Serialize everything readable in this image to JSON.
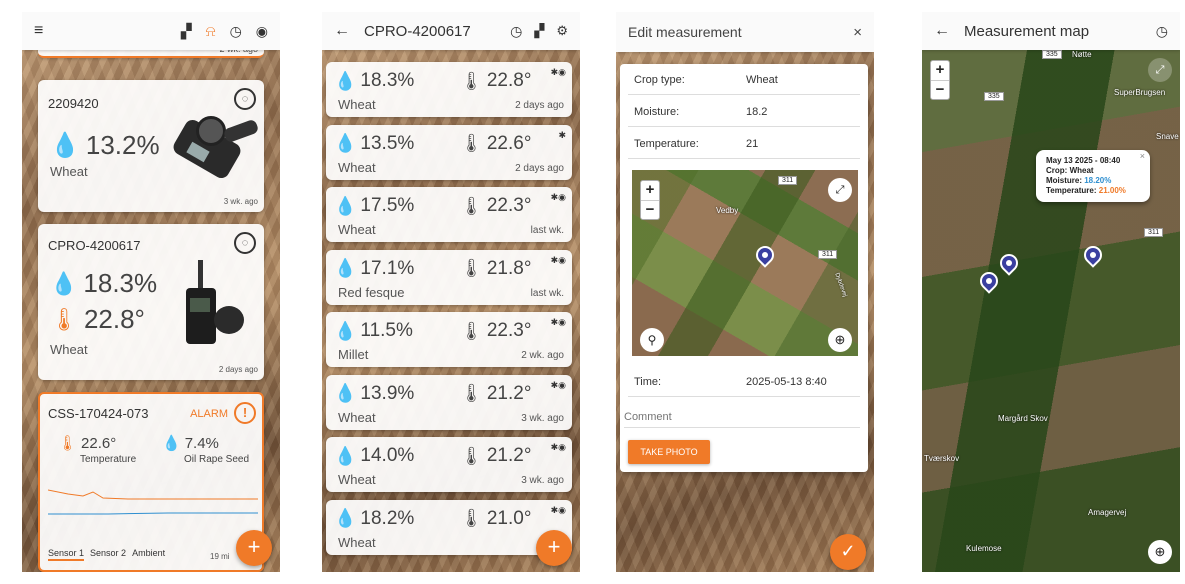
{
  "screen1": {
    "top_card_partial": "2 wk. ago",
    "devices": [
      {
        "name": "2209420",
        "moisture": "13.2%",
        "crop": "Wheat",
        "age": "3 wk. ago"
      },
      {
        "name": "CPRO-4200617",
        "moisture": "18.3%",
        "temperature": "22.8°",
        "crop": "Wheat",
        "age": "2 days ago"
      }
    ],
    "alarm_device": {
      "name": "CSS-170424-073",
      "alarm_label": "ALARM",
      "temperature": "22.6°",
      "temperature_label": "Temperature",
      "moisture": "7.4%",
      "crop": "Oil Rape Seed",
      "tabs": [
        "Sensor 1",
        "Sensor 2",
        "Ambient"
      ],
      "age": "19 mi"
    },
    "fab": "+"
  },
  "screen2": {
    "title": "CPRO-4200617",
    "rows": [
      {
        "moisture": "18.3%",
        "temperature": "22.8°",
        "crop": "Wheat",
        "age": "2 days ago",
        "bt": "✱◉"
      },
      {
        "moisture": "13.5%",
        "temperature": "22.6°",
        "crop": "Wheat",
        "age": "2 days ago",
        "bt": "✱"
      },
      {
        "moisture": "17.5%",
        "temperature": "22.3°",
        "crop": "Wheat",
        "age": "last wk.",
        "bt": "✱◉"
      },
      {
        "moisture": "17.1%",
        "temperature": "21.8°",
        "crop": "Red fesque",
        "age": "last wk.",
        "bt": "✱◉"
      },
      {
        "moisture": "11.5%",
        "temperature": "22.3°",
        "crop": "Millet",
        "age": "2 wk. ago",
        "bt": "✱◉"
      },
      {
        "moisture": "13.9%",
        "temperature": "21.2°",
        "crop": "Wheat",
        "age": "3 wk. ago",
        "bt": "✱◉"
      },
      {
        "moisture": "14.0%",
        "temperature": "21.2°",
        "crop": "Wheat",
        "age": "3 wk. ago",
        "bt": "✱◉"
      },
      {
        "moisture": "18.2%",
        "temperature": "21.0°",
        "crop": "Wheat",
        "age": "3 w",
        "bt": "✱◉"
      }
    ],
    "fab": "+"
  },
  "screen3": {
    "title": "Edit measurement",
    "close": "×",
    "fields": [
      {
        "label": "Crop type:",
        "value": "Wheat"
      },
      {
        "label": "Moisture:",
        "value": "18.2"
      },
      {
        "label": "Temperature:",
        "value": "21"
      }
    ],
    "map": {
      "place": "Vedby",
      "road1": "311",
      "road2": "311",
      "road3": "Dybdevej"
    },
    "time_label": "Time:",
    "time_value": "2025-05-13 8:40",
    "comment_placeholder": "Comment",
    "photo_button": "TAKE PHOTO",
    "confirm": "✓"
  },
  "screen4": {
    "title": "Measurement map",
    "popup": {
      "date": "May 13 2025 - 08:40",
      "crop_label": "Crop:",
      "crop": "Wheat",
      "moisture_label": "Moisture:",
      "moisture": "18.20%",
      "temperature_label": "Temperature:",
      "temperature": "21.00%"
    },
    "places": [
      "Nøtte",
      "SuperBrugsen",
      "Snave",
      "Margård Skov",
      "Tværskov",
      "Amagervej",
      "Kulemose"
    ],
    "roads": [
      "335",
      "335",
      "311"
    ]
  },
  "colors": {
    "accent": "#f07a28",
    "moisture_blue": "#2f8fd0",
    "pin": "#3a3fa0"
  }
}
